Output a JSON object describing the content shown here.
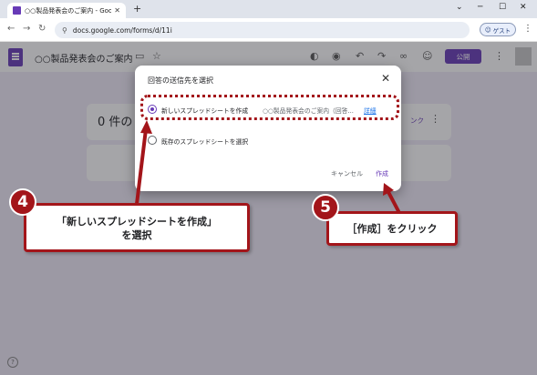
{
  "browser": {
    "tab_title": "○○製品発表会のご案内 - Google",
    "tab_close": "✕",
    "new_tab": "+",
    "url": "docs.google.com/forms/d/11i",
    "guest_label": "ゲスト",
    "window_controls": [
      "⌄",
      "─",
      "☐",
      "✕"
    ]
  },
  "forms": {
    "title": "○○製品発表会のご案内",
    "publish_label": "公開",
    "icons": [
      "palette-icon",
      "eye-icon",
      "undo-icon",
      "redo-icon",
      "link-icon",
      "add-person-icon"
    ]
  },
  "responses": {
    "count_label": "0 件の",
    "link_label": "ンク"
  },
  "dialog": {
    "title": "回答の送信先を選択",
    "option_new_label": "新しいスプレッドシートを作成",
    "option_new_name": "○○製品発表会のご案内（回答...",
    "option_new_detail": "詳細",
    "option_existing_label": "既存のスプレッドシートを選択",
    "cancel_label": "キャンセル",
    "create_label": "作成"
  },
  "annotations": {
    "step4_number": "4",
    "step4_line1": "「新しいスプレッドシートを作成」",
    "step4_line2": "を選択",
    "step5_number": "5",
    "step5_text": "［作成］をクリック"
  },
  "colors": {
    "accent": "#673ab7",
    "annotation": "#a3151a",
    "link": "#1a73e8"
  }
}
